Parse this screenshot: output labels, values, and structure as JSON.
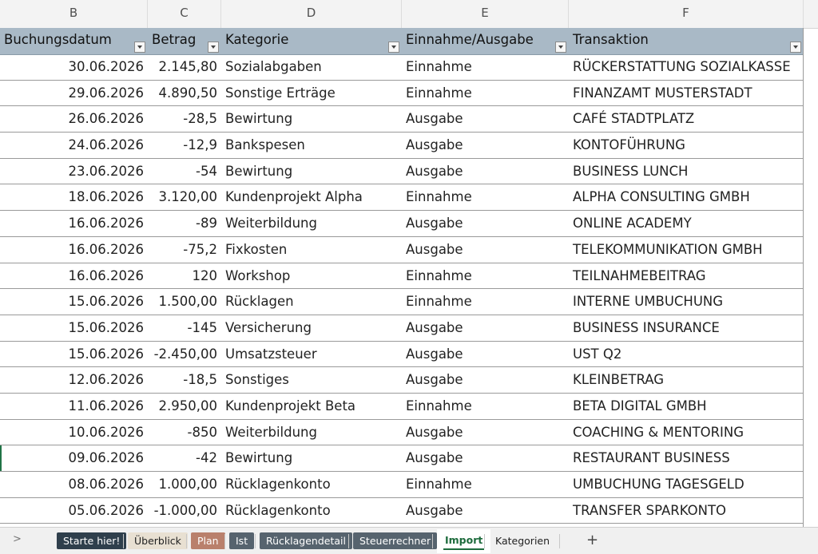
{
  "columns": [
    "B",
    "C",
    "D",
    "E",
    "F"
  ],
  "table": {
    "headers": [
      "Buchungsdatum",
      "Betrag",
      "Kategorie",
      "Einnahme/Ausgabe",
      "Transaktion"
    ],
    "rows": [
      [
        "30.06.2026",
        "2.145,80",
        "Sozialabgaben",
        "Einnahme",
        "RÜCKERSTATTUNG SOZIALKASSE"
      ],
      [
        "29.06.2026",
        "4.890,50",
        "Sonstige Erträge",
        "Einnahme",
        "FINANZAMT MUSTERSTADT"
      ],
      [
        "26.06.2026",
        "-28,5",
        "Bewirtung",
        "Ausgabe",
        "CAFÉ STADTPLATZ"
      ],
      [
        "24.06.2026",
        "-12,9",
        "Bankspesen",
        "Ausgabe",
        "KONTOFÜHRUNG"
      ],
      [
        "23.06.2026",
        "-54",
        "Bewirtung",
        "Ausgabe",
        "BUSINESS LUNCH"
      ],
      [
        "18.06.2026",
        "3.120,00",
        "Kundenprojekt Alpha",
        "Einnahme",
        "ALPHA CONSULTING GMBH"
      ],
      [
        "16.06.2026",
        "-89",
        "Weiterbildung",
        "Ausgabe",
        "ONLINE ACADEMY"
      ],
      [
        "16.06.2026",
        "-75,2",
        "Fixkosten",
        "Ausgabe",
        "TELEKOMMUNIKATION GMBH"
      ],
      [
        "16.06.2026",
        "120",
        "Workshop",
        "Einnahme",
        "TEILNAHMEBEITRAG"
      ],
      [
        "15.06.2026",
        "1.500,00",
        "Rücklagen",
        "Einnahme",
        "INTERNE UMBUCHUNG"
      ],
      [
        "15.06.2026",
        "-145",
        "Versicherung",
        "Ausgabe",
        "BUSINESS INSURANCE"
      ],
      [
        "15.06.2026",
        "-2.450,00",
        "Umsatzsteuer",
        "Ausgabe",
        "UST Q2"
      ],
      [
        "12.06.2026",
        "-18,5",
        "Sonstiges",
        "Ausgabe",
        "KLEINBETRAG"
      ],
      [
        "11.06.2026",
        "2.950,00",
        "Kundenprojekt Beta",
        "Einnahme",
        "BETA DIGITAL GMBH"
      ],
      [
        "10.06.2026",
        "-850",
        "Weiterbildung",
        "Ausgabe",
        "COACHING & MENTORING"
      ],
      [
        "09.06.2026",
        "-42",
        "Bewirtung",
        "Ausgabe",
        "RESTAURANT BUSINESS"
      ],
      [
        "08.06.2026",
        "1.000,00",
        "Rücklagenkonto",
        "Einnahme",
        "UMBUCHUNG TAGESGELD"
      ],
      [
        "05.06.2026",
        "-1.000,00",
        "Rücklagenkonto",
        "Ausgabe",
        "TRANSFER SPARKONTO"
      ]
    ]
  },
  "sheet_tabs": [
    {
      "label": "Starte hier!",
      "bg": "#2f3f4c",
      "fg": "#ffffff"
    },
    {
      "label": "Überblick",
      "bg": "#e8e0d2",
      "fg": "#222222"
    },
    {
      "label": "Plan",
      "bg": "#b9806c",
      "fg": "#ffffff"
    },
    {
      "label": "Ist",
      "bg": "#56636e",
      "fg": "#ffffff"
    },
    {
      "label": "Rücklagendetail",
      "bg": "#56636e",
      "fg": "#ffffff"
    },
    {
      "label": "Steuerrechner",
      "bg": "#56636e",
      "fg": "#ffffff"
    },
    {
      "label": "Import",
      "bg": "#ffffff",
      "fg": "#1d6b3c"
    },
    {
      "label": "Kategorien",
      "bg": "transparent",
      "fg": "#222222"
    }
  ],
  "active_tab": "Import",
  "add_sheet_label": "+",
  "scroll_label": ">"
}
